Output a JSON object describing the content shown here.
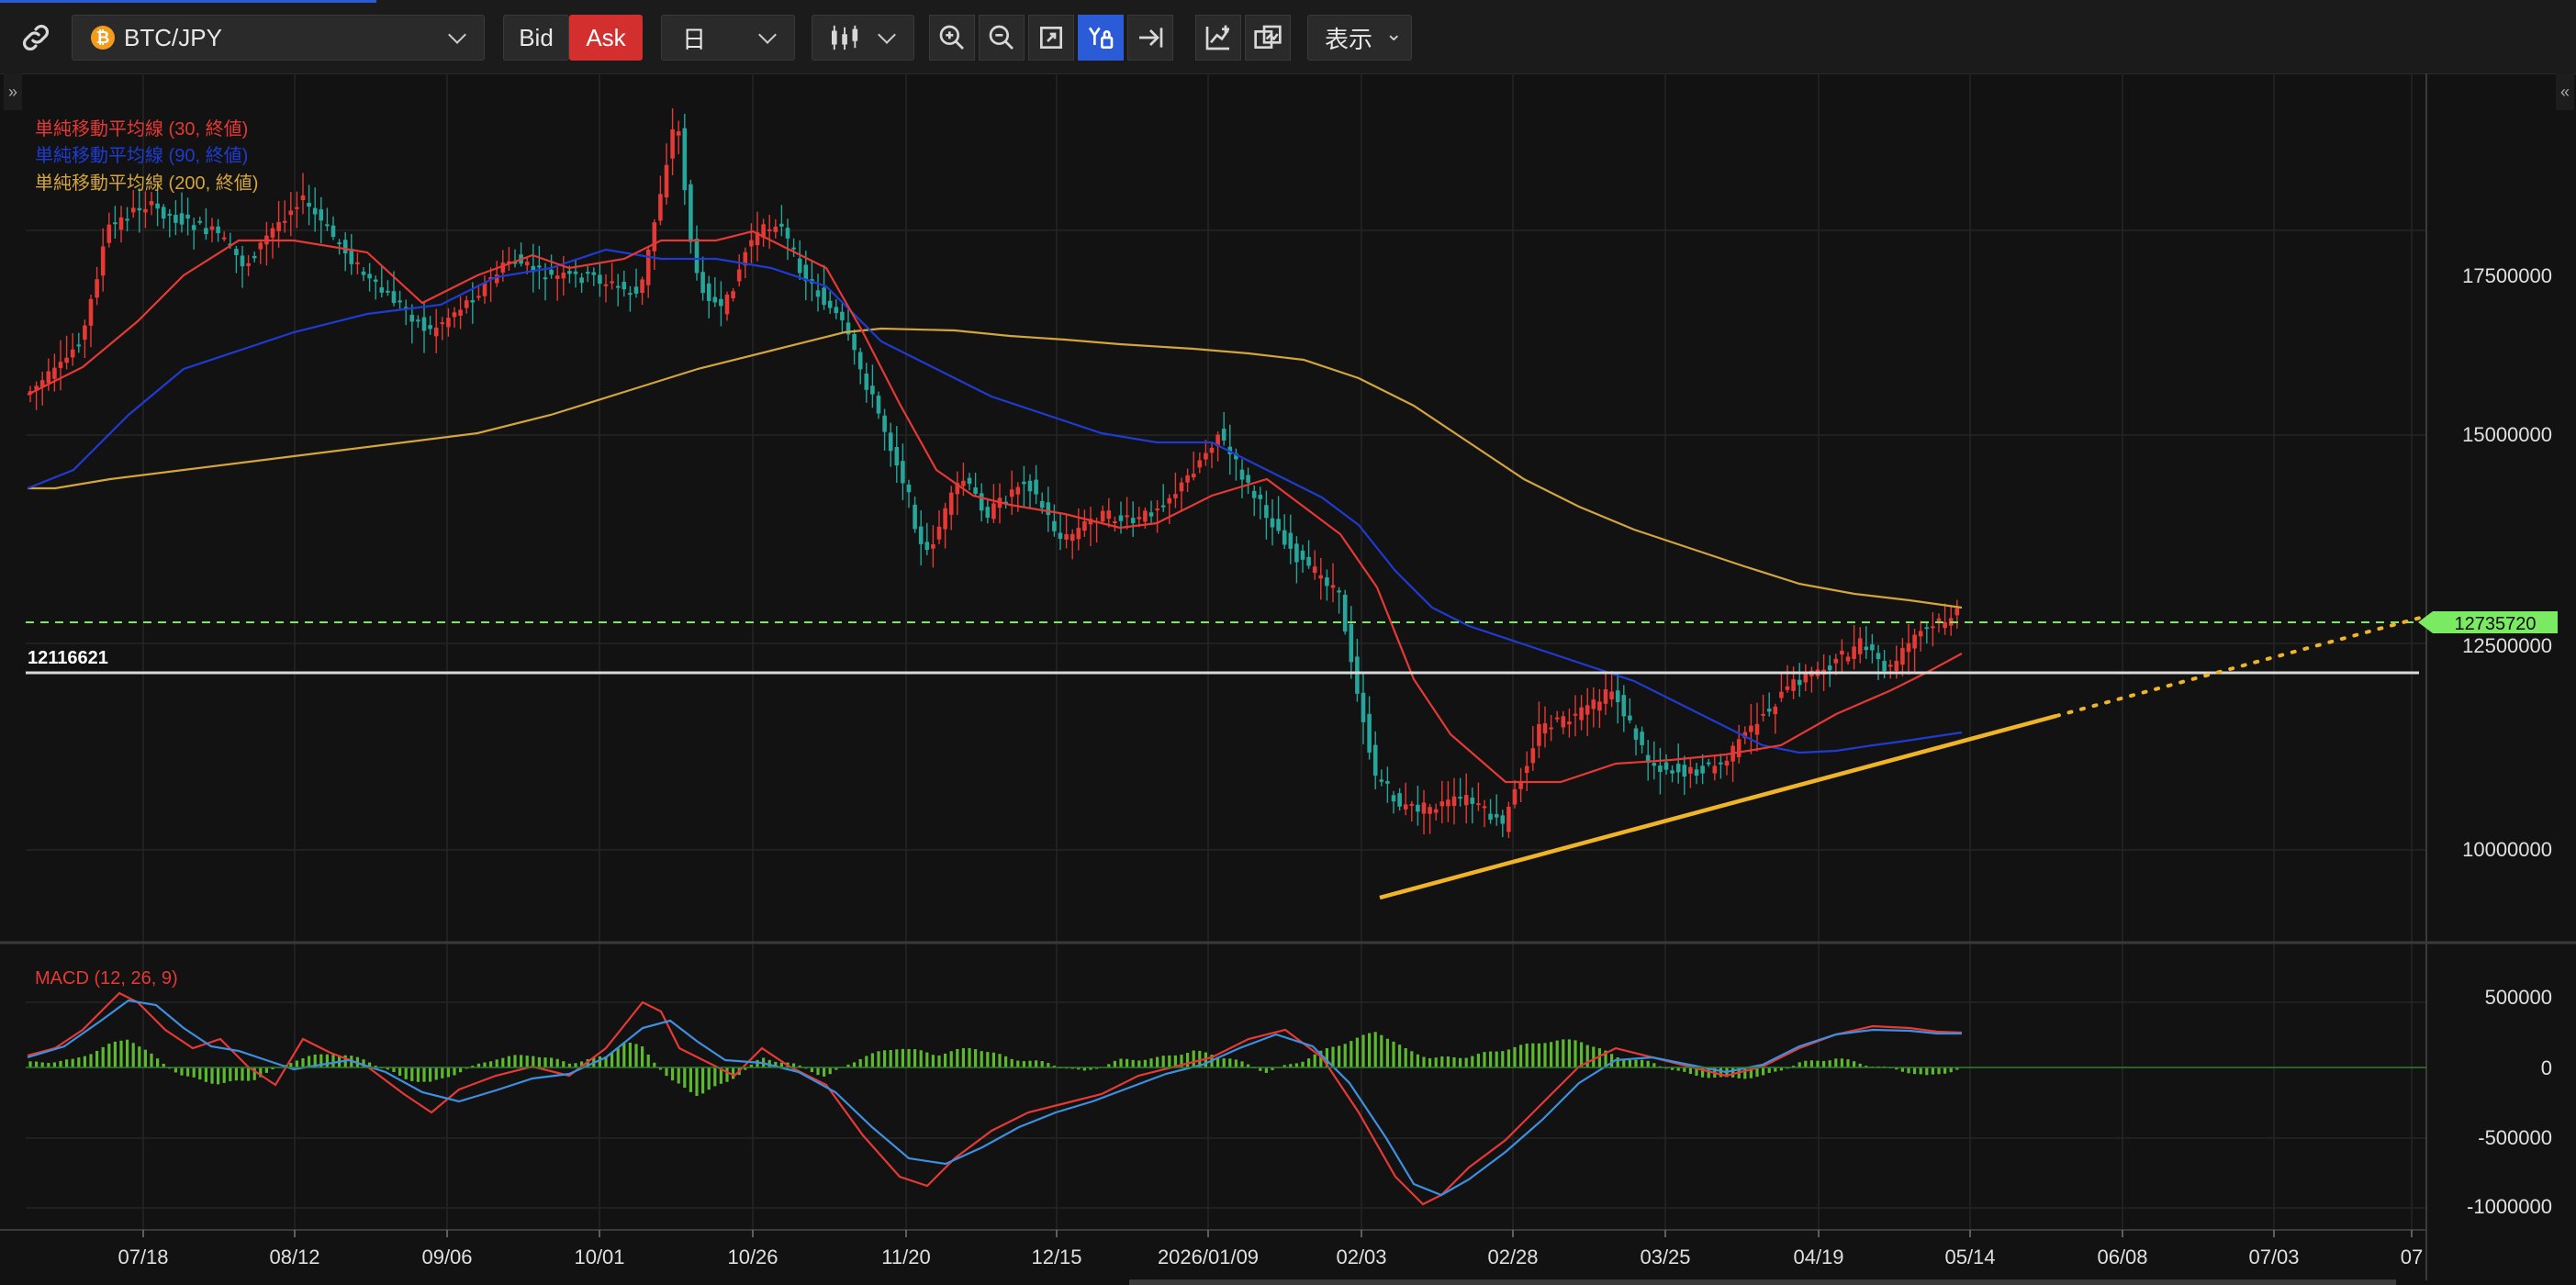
{
  "toolbar": {
    "symbol": "BTC/JPY",
    "coin_glyph": "₿",
    "bid_label": "Bid",
    "ask_label": "Ask",
    "timeframe": "日",
    "display_label": "表示",
    "display_caret": "⌄"
  },
  "legend": {
    "sma30": "単純移動平均線 (30, 終値)",
    "sma90": "単純移動平均線 (90, 終値)",
    "sma200": "単純移動平均線 (200, 終値)",
    "macd": "MACD (12, 26, 9)"
  },
  "price_axis": {
    "ticks": [
      "17500000",
      "15000000",
      "12500000",
      "10000000"
    ],
    "current_price": "12735720",
    "line_level_label": "12116621"
  },
  "macd_axis": {
    "ticks": [
      "500000",
      "0",
      "-500000",
      "-1000000"
    ]
  },
  "time_axis": {
    "labels": [
      "07/18",
      "08/12",
      "09/06",
      "10/01",
      "10/26",
      "11/20",
      "12/15",
      "2026/01/09",
      "02/03",
      "02/28",
      "03/25",
      "04/19",
      "05/14",
      "06/08",
      "07/03",
      "07"
    ]
  },
  "colors": {
    "bullish": "#e53935",
    "bearish": "#26a69a",
    "sma30": "#e53935",
    "sma90": "#1f3bd1",
    "sma200": "#d4a53c",
    "trendline": "#f0b429",
    "macd_line": "#e53935",
    "signal_line": "#3f8fe0",
    "histogram": "#5cb82e",
    "current_price_tag": "#7bea63"
  }
}
